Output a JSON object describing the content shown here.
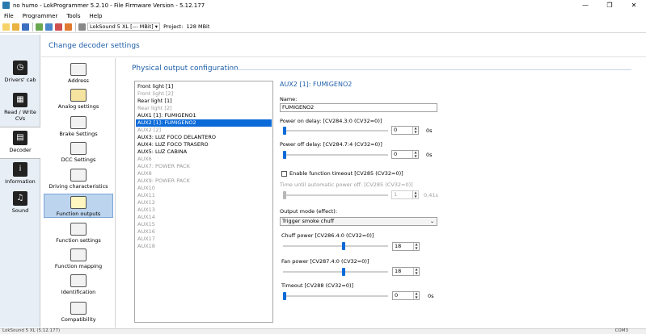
{
  "window": {
    "title": "no humo - LokProgrammer 5.2.10 - File Firmware Version - 5.12.177",
    "controls": [
      "—",
      "❐",
      "✕"
    ]
  },
  "menu": [
    "File",
    "Programmer",
    "Tools",
    "Help"
  ],
  "toolbar": {
    "decoder_label": "LokSound 5 XL [--- MBit]",
    "project_label": "Project:",
    "project_size": "128 MBit"
  },
  "leftnav": [
    {
      "label": "Drivers' cab",
      "icon": "speedometer-icon"
    },
    {
      "label": "Read / Write CVs",
      "icon": "chip-icon"
    },
    {
      "label": "Decoder",
      "icon": "decoder-icon",
      "active": true
    },
    {
      "label": "Information",
      "icon": "info-icon"
    },
    {
      "label": "Sound",
      "icon": "music-icon"
    }
  ],
  "header": {
    "title": "Change decoder settings"
  },
  "subnav": [
    {
      "label": "Address",
      "icon": "envelope-icon"
    },
    {
      "label": "Analog settings",
      "icon": "battery-icon"
    },
    {
      "label": "Brake Settings",
      "icon": "brake-icon"
    },
    {
      "label": "DCC Settings",
      "icon": "dcc-icon"
    },
    {
      "label": "Driving characteristics",
      "icon": "sliders-icon"
    },
    {
      "label": "Function outputs",
      "icon": "bulb-icon",
      "active": true
    },
    {
      "label": "Function settings",
      "icon": "function-icon"
    },
    {
      "label": "Function mapping",
      "icon": "mapping-icon"
    },
    {
      "label": "Identification",
      "icon": "id-card-icon"
    },
    {
      "label": "Compatibility",
      "icon": "compat-icon"
    }
  ],
  "section": {
    "title": "Physical output configuration"
  },
  "outputs": [
    {
      "label": "Front light [1]",
      "enabled": true
    },
    {
      "label": "Front light [2]",
      "enabled": false
    },
    {
      "label": "Rear light [1]",
      "enabled": true
    },
    {
      "label": "Rear light [2]",
      "enabled": false
    },
    {
      "label": "AUX1 [1]: FUMIGENO1",
      "enabled": true
    },
    {
      "label": "AUX2 [1]: FUMIGENO2",
      "enabled": true,
      "selected": true
    },
    {
      "label": "AUX2 [2]",
      "enabled": false
    },
    {
      "label": "AUX3: LUZ FOCO DELANTERO",
      "enabled": true
    },
    {
      "label": "AUX4: LUZ FOCO TRASERO",
      "enabled": true
    },
    {
      "label": "AUX5: LUZ CABINA",
      "enabled": true
    },
    {
      "label": "AUX6",
      "enabled": false
    },
    {
      "label": "AUX7: POWER PACK",
      "enabled": false
    },
    {
      "label": "AUX8",
      "enabled": false
    },
    {
      "label": "AUX9: POWER PACK",
      "enabled": false
    },
    {
      "label": "AUX10",
      "enabled": false
    },
    {
      "label": "AUX11",
      "enabled": false
    },
    {
      "label": "AUX12",
      "enabled": false
    },
    {
      "label": "AUX13",
      "enabled": false
    },
    {
      "label": "AUX14",
      "enabled": false
    },
    {
      "label": "AUX15",
      "enabled": false
    },
    {
      "label": "AUX16",
      "enabled": false
    },
    {
      "label": "AUX17",
      "enabled": false
    },
    {
      "label": "AUX18",
      "enabled": false
    }
  ],
  "detail": {
    "title": "AUX2 [1]: FUMIGENO2",
    "name_label": "Name:",
    "name_value": "FUMIGENO2",
    "power_on_label": "Power on delay: [CV284.3:0 (CV32=0)]",
    "power_on_value": "0",
    "power_on_unit": "0s",
    "power_on_fraction": 0,
    "power_off_label": "Power off delay: [CV284.7:4 (CV32=0)]",
    "power_off_value": "0",
    "power_off_unit": "0s",
    "power_off_fraction": 0,
    "timeout_check_label": "Enable function timeout [CV285 (CV32=0)]",
    "auto_off_label": "Time until automatic power off: [CV285 (CV32=0)]",
    "auto_off_value": "1",
    "auto_off_unit": "0,41s",
    "auto_off_fraction": 0,
    "mode_label": "Output mode (effect):",
    "mode_value": "Trigger smoke chuff",
    "chuff_label": "Chuff power [CV286.4:0 (CV32=0)]",
    "chuff_value": "18",
    "chuff_fraction": 0.58,
    "fan_label": "Fan power [CV287.4:0 (CV32=0)]",
    "fan_value": "18",
    "fan_fraction": 0.58,
    "timeout_label": "Timeout [CV288 (CV32=0)]",
    "timeout_value": "0",
    "timeout_unit": "0s",
    "timeout_fraction": 0
  },
  "status": {
    "left": "LokSound 5 XL (5.12.177)",
    "right": "COM3"
  },
  "colors": {
    "accent": "#0a6ad8",
    "header_text": "#1f5fa8",
    "selected_sub": "#bcd4ee"
  }
}
